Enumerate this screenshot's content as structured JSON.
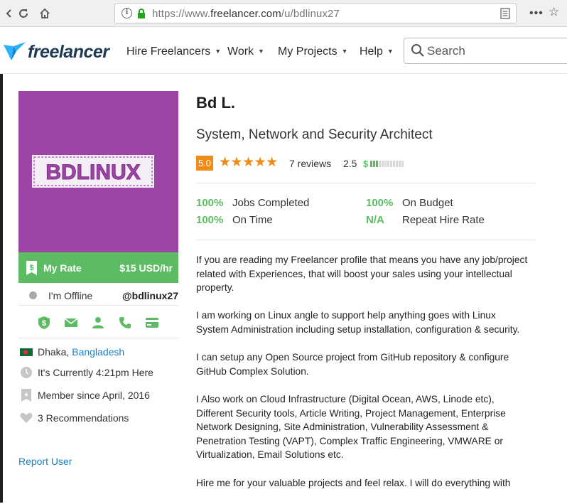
{
  "browser": {
    "url_prefix": "https://www.",
    "url_domain": "freelancer.com",
    "url_path": "/u/bdlinux27"
  },
  "header": {
    "logo_text": "freelancer",
    "nav": [
      {
        "label": "Hire Freelancers"
      },
      {
        "label": "Work"
      },
      {
        "label": "My Projects"
      },
      {
        "label": "Help"
      }
    ],
    "search_placeholder": "Search"
  },
  "sidebar": {
    "avatar_text": "BDLINUX",
    "rate_label": "My Rate",
    "rate_value": "$15 USD/hr",
    "status": "I'm Offline",
    "username": "@bdlinux27",
    "location_city": "Dhaka,",
    "location_country": "Bangladesh",
    "local_time": "It's Currently 4:21pm Here",
    "member_since": "Member since April, 2016",
    "recommendations": "3 Recommendations",
    "report_user": "Report User",
    "colors": {
      "avatar_bg": "#9c45a5",
      "rate_bg": "#5dbb63",
      "link": "#1b81c5"
    }
  },
  "profile": {
    "name": "Bd L.",
    "title": "System, Network and Security Architect",
    "rating": "5.0",
    "stars": "★★★★★",
    "reviews": "7 reviews",
    "earnings_score": "2.5",
    "earnings_dollar": "$",
    "earnings_level": 0.25,
    "stats": {
      "jobs_completed_pct": "100%",
      "jobs_completed_label": "Jobs Completed",
      "on_time_pct": "100%",
      "on_time_label": "On Time",
      "on_budget_pct": "100%",
      "on_budget_label": "On Budget",
      "repeat_hire_pct": "N/A",
      "repeat_hire_label": "Repeat Hire Rate"
    },
    "bio": [
      "If you are reading my Freelancer profile that means you have any job/project related with Experiences, that will boost your sales using your intellectual property.",
      "I am working on Linux angle to support help anything goes with Linux System Administration including setup installation, configuration & security.",
      "I can setup any Open Source project from GitHub repository & configure GitHub Complex Solution.",
      "I Also work on Cloud Infrastructure (Digital Ocean, AWS, Linode etc), Different Security tools, Article Writing, Project Management, Enterprise Network Designing, Site Administration, Vulnerability Assessment & Penetration Testing (VAPT), Complex Traffic Engineering, VMWARE or Virtualization, Email  Solutions etc.",
      "Hire me for your valuable projects and feel relax. I will do everything with"
    ],
    "colors": {
      "accent": "#f08c16",
      "success": "#5dbb63"
    }
  }
}
